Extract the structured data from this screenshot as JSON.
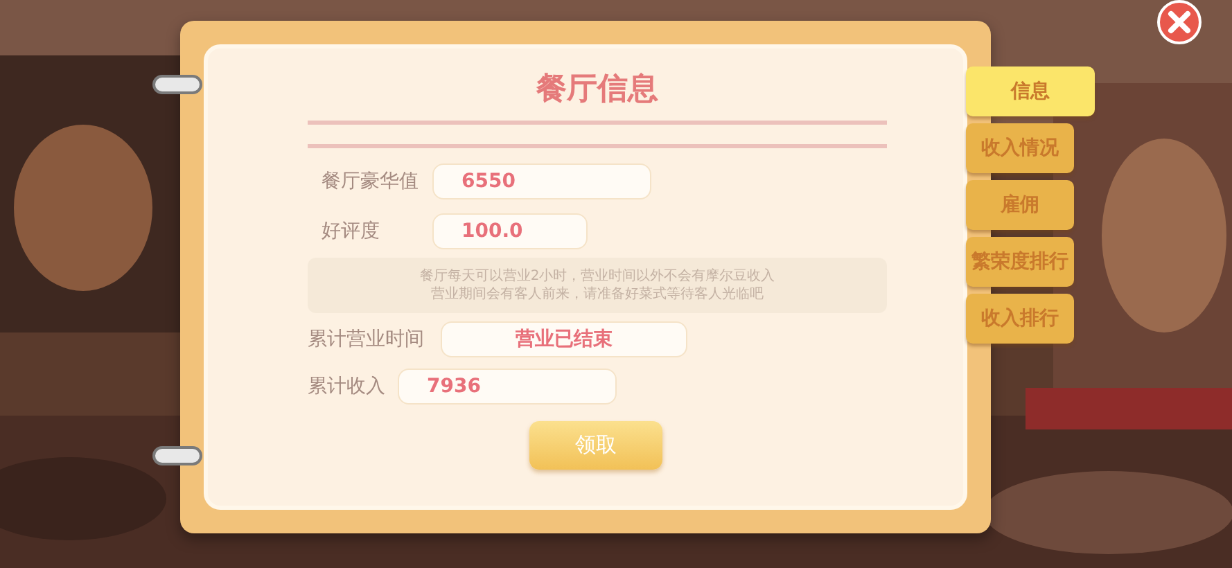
{
  "title": "餐厅信息",
  "fields": [
    {
      "label": "餐厅豪华值",
      "value": "6550"
    },
    {
      "label": "好评度",
      "value": "100.0"
    }
  ],
  "note": [
    "餐厅每天可以营业2小时，营业时间以外不会有摩尔豆收入",
    "营业期间会有客人前来，请准备好菜式等待客人光临吧"
  ],
  "totals": [
    {
      "label": "累计营业时间",
      "value": "营业已结束",
      "kind": "status"
    },
    {
      "label": "累计收入",
      "value": "7936",
      "kind": "number"
    }
  ],
  "claim_button": "领取",
  "tabs": [
    {
      "label": "信息",
      "selected": true
    },
    {
      "label": "收入情况",
      "selected": false
    },
    {
      "label": "雇佣",
      "selected": false
    },
    {
      "label": "繁荣度排行",
      "selected": false
    },
    {
      "label": "收入排行",
      "selected": false
    }
  ]
}
